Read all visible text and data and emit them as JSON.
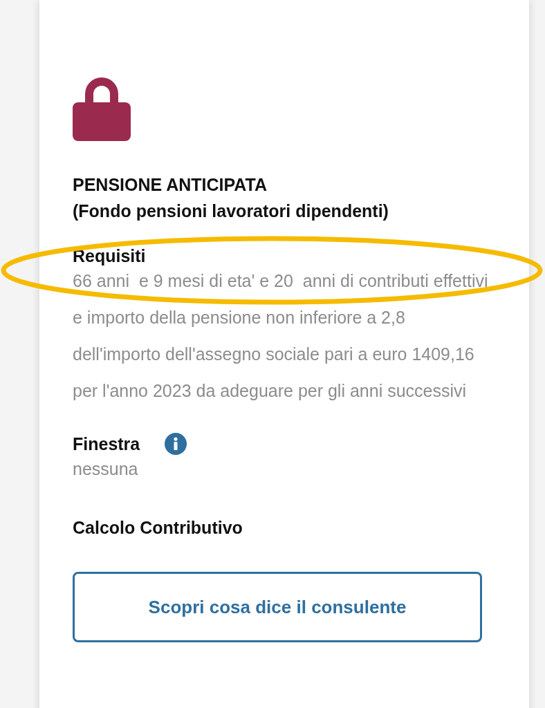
{
  "card": {
    "title": "PENSIONE ANTICIPATA",
    "subtitle": "(Fondo pensioni lavoratori dipendenti)",
    "sections": [
      {
        "kind": "text",
        "label": "Requisiti",
        "value": "66 anni  e 9 mesi di eta' e 20  anni di contributi effettivi e importo della pensione non inferiore a 2,8 dell'importo dell'assegno sociale pari a euro 1409,16 per l'anno 2023 da adeguare per gli anni successivi",
        "info": false
      },
      {
        "kind": "text",
        "label": "Finestra",
        "value": "nessuna",
        "info": true
      },
      {
        "kind": "heading",
        "label": "Calcolo Contributivo",
        "info": false
      }
    ],
    "button": "Scopri cosa dice il consulente"
  }
}
